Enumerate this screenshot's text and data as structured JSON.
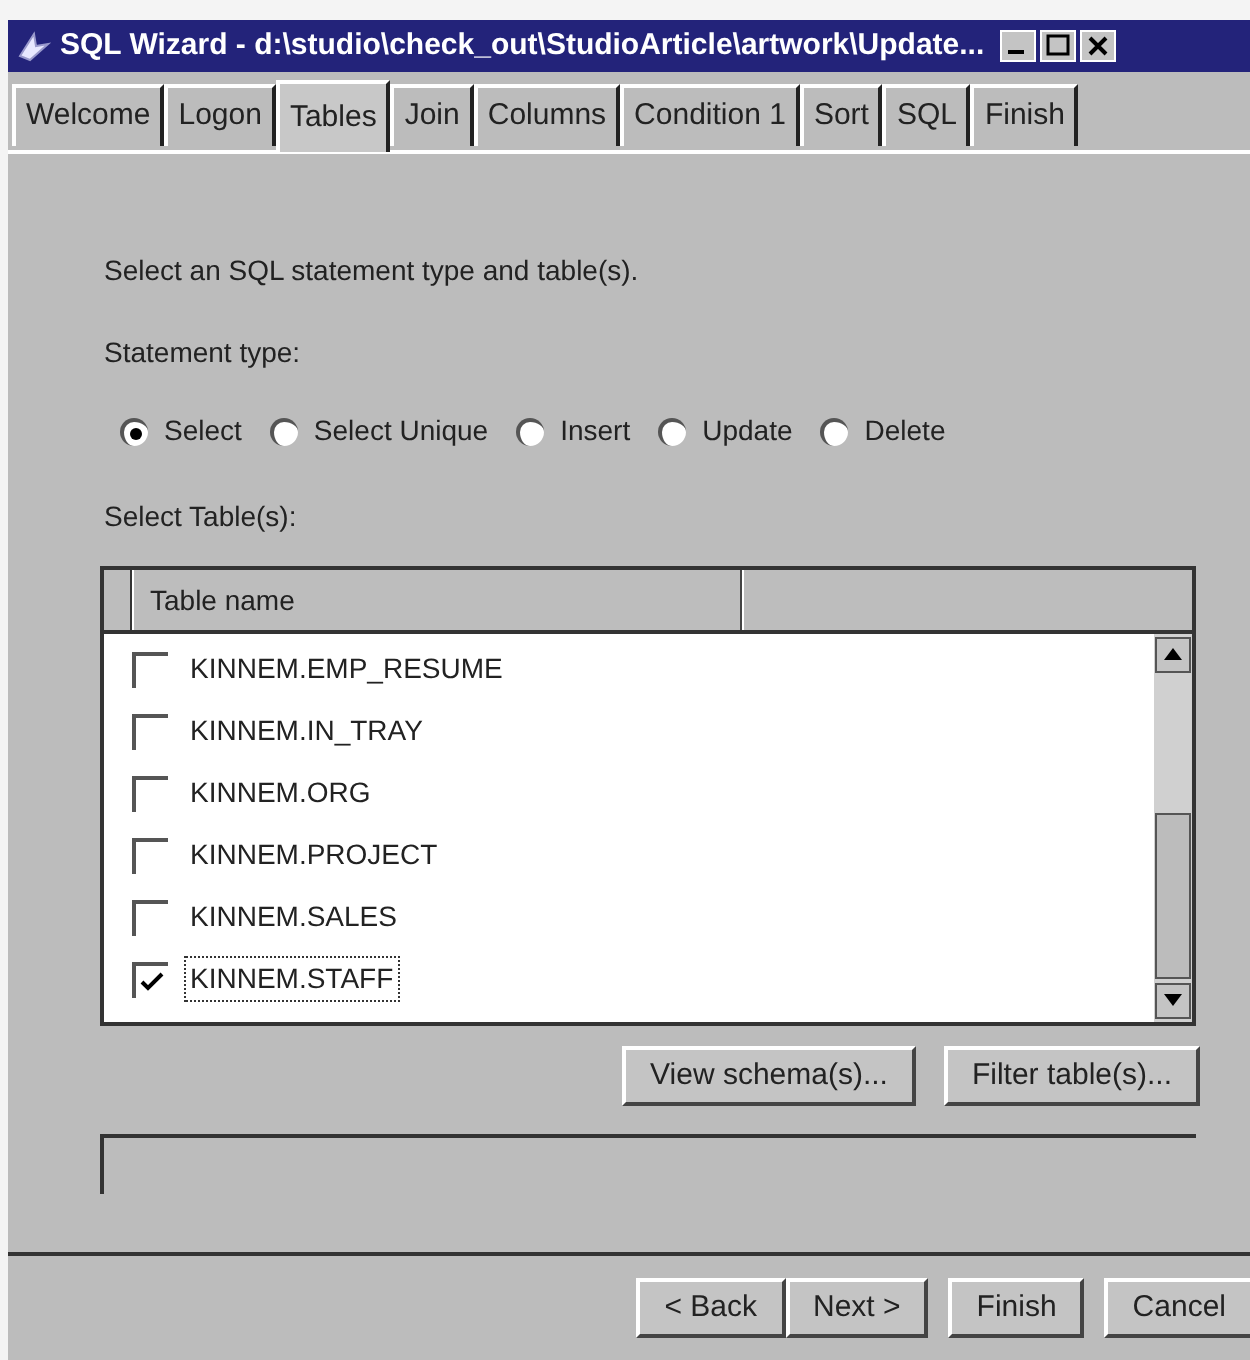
{
  "window": {
    "title": "SQL Wizard - d:\\studio\\check_out\\StudioArticle\\artwork\\Update..."
  },
  "tabs": [
    {
      "label": "Welcome",
      "selected": false
    },
    {
      "label": "Logon",
      "selected": false
    },
    {
      "label": "Tables",
      "selected": true
    },
    {
      "label": "Join",
      "selected": false
    },
    {
      "label": "Columns",
      "selected": false
    },
    {
      "label": "Condition 1",
      "selected": false
    },
    {
      "label": "Sort",
      "selected": false
    },
    {
      "label": "SQL",
      "selected": false
    },
    {
      "label": "Finish",
      "selected": false
    }
  ],
  "instruction": "Select an SQL statement type and table(s).",
  "statement_type": {
    "label": "Statement type:",
    "options": [
      {
        "label": "Select",
        "selected": true
      },
      {
        "label": "Select Unique",
        "selected": false
      },
      {
        "label": "Insert",
        "selected": false
      },
      {
        "label": "Update",
        "selected": false
      },
      {
        "label": "Delete",
        "selected": false
      }
    ]
  },
  "tables": {
    "label": "Select Table(s):",
    "columns": [
      "Table name"
    ],
    "rows": [
      {
        "name": "KINNEM.EMP_RESUME",
        "checked": false,
        "focused": false
      },
      {
        "name": "KINNEM.IN_TRAY",
        "checked": false,
        "focused": false
      },
      {
        "name": "KINNEM.ORG",
        "checked": false,
        "focused": false
      },
      {
        "name": "KINNEM.PROJECT",
        "checked": false,
        "focused": false
      },
      {
        "name": "KINNEM.SALES",
        "checked": false,
        "focused": false
      },
      {
        "name": "KINNEM.STAFF",
        "checked": true,
        "focused": true
      }
    ]
  },
  "table_buttons": [
    "View schema(s)...",
    "Filter table(s)..."
  ],
  "nav_buttons": [
    "< Back",
    "Next >",
    "Finish",
    "Cancel"
  ]
}
